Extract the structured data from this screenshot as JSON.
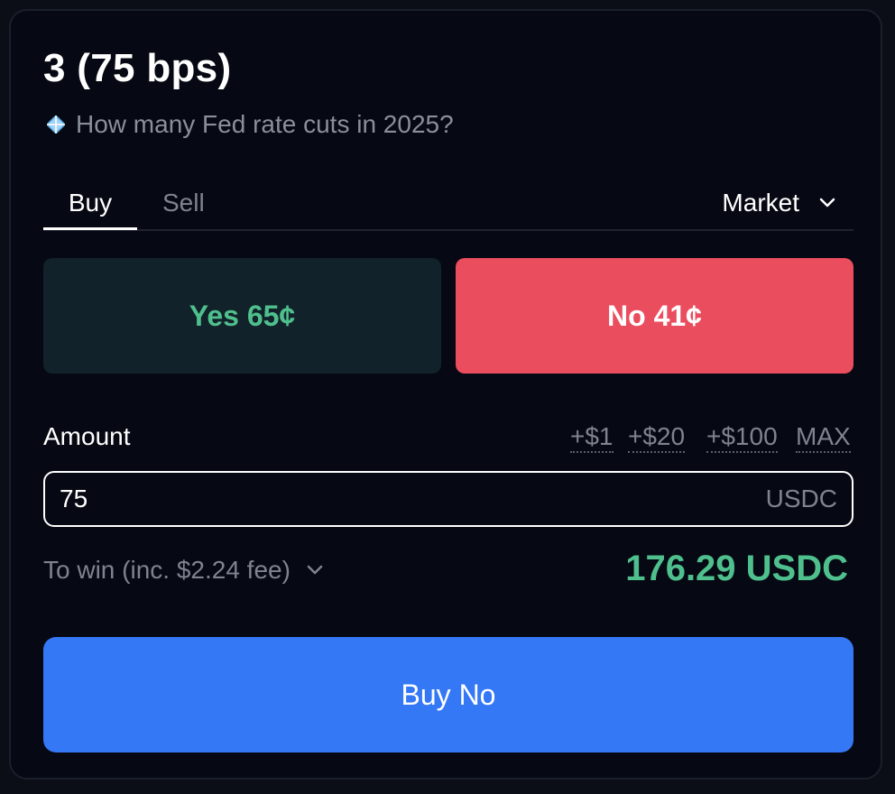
{
  "market": {
    "title": "3 (75 bps)",
    "question": "How many Fed rate cuts in 2025?"
  },
  "tabs": {
    "buy": "Buy",
    "sell": "Sell",
    "active": "Buy"
  },
  "order_type": {
    "selected": "Market"
  },
  "outcomes": {
    "yes_label": "Yes 65¢",
    "no_label": "No 41¢",
    "selected": "No"
  },
  "amount": {
    "label": "Amount",
    "value": "75",
    "unit": "USDC",
    "quick_add": [
      "+$1",
      "+$20",
      "+$100",
      "MAX"
    ]
  },
  "summary": {
    "to_win_label": "To win (inc. $2.24 fee)",
    "payout": "176.29 USDC"
  },
  "action": {
    "label": "Buy No"
  },
  "colors": {
    "background": "#060913",
    "yes_green": "#4fc08d",
    "no_red": "#ea4d5e",
    "primary_blue": "#3478f6",
    "muted_text": "#7f8390"
  },
  "icons": {
    "question": "diamond-icon",
    "order_type": "chevron-down-icon",
    "to_win": "chevron-down-icon"
  }
}
